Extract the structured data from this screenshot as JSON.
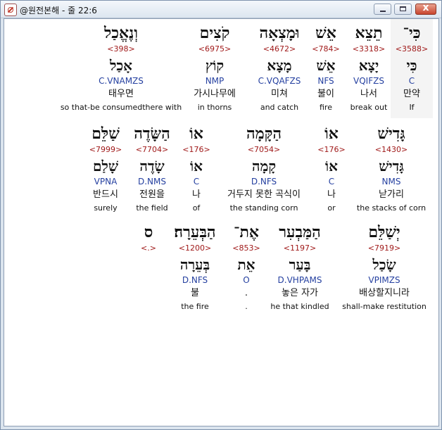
{
  "window": {
    "title": "@원전본해 - 줄 22:6",
    "minimize_label": "",
    "maximize_label": "",
    "close_label": "x"
  },
  "verse": {
    "words": [
      {
        "hebrew": "כִּי־",
        "strong": "<3588>",
        "lexeme": "כִּי",
        "morph": "C",
        "korean": "만약",
        "english": "If"
      },
      {
        "hebrew": "תֵצֵא",
        "strong": "<3318>",
        "lexeme": "יָצָא",
        "morph": "VQIFZS",
        "korean": "나서",
        "english": "break out"
      },
      {
        "hebrew": "אֵשׁ",
        "strong": "<784>",
        "lexeme": "אֵשׁ",
        "morph": "NFS",
        "korean": "불이",
        "english": "fire"
      },
      {
        "hebrew": "וּמָצְאָה",
        "strong": "<4672>",
        "lexeme": "מָצָא",
        "morph": "C.VQAFZS",
        "korean": "미쳐",
        "english": "and catch"
      },
      {
        "hebrew": "קֹצִים",
        "strong": "<6975>",
        "lexeme": "קוֹץ",
        "morph": "NMP",
        "korean": "가시나무에",
        "english": "in thorns"
      },
      {
        "hebrew": "וְנֶאֱכַל",
        "strong": "<398>",
        "lexeme": "אָכַל",
        "morph": "C.VNAMZS",
        "korean": "태우면",
        "english": "so that-be consumedthere with"
      },
      {
        "hebrew": "גָּדִישׁ",
        "strong": "<1430>",
        "lexeme": "גָּדִישׁ",
        "morph": "NMS",
        "korean": "낟가리",
        "english": "the stacks of corn"
      },
      {
        "hebrew": "אוֹ",
        "strong": "<176>",
        "lexeme": "אוֹ",
        "morph": "C",
        "korean": "나",
        "english": "or"
      },
      {
        "hebrew": "הַקָּמָה",
        "strong": "<7054>",
        "lexeme": "קָמָה",
        "morph": "D.NFS",
        "korean": "거두지 못한 곡식이",
        "english": "the standing corn"
      },
      {
        "hebrew": "אוֹ",
        "strong": "<176>",
        "lexeme": "אוֹ",
        "morph": "C",
        "korean": "나",
        "english": "of"
      },
      {
        "hebrew": "הַשָּׂדֶה",
        "strong": "<7704>",
        "lexeme": "שָׂדֶה",
        "morph": "D.NMS",
        "korean": "전원을",
        "english": "the field"
      },
      {
        "hebrew": "שַׁלֵּם",
        "strong": "<7999>",
        "lexeme": "שָׁלַם",
        "morph": "VPNA",
        "korean": "반드시",
        "english": "surely"
      },
      {
        "hebrew": "יְשַׁלֵּם",
        "strong": "<7919>",
        "lexeme": "שָׂכַל",
        "morph": "VPIMZS",
        "korean": "배상할지니라",
        "english": "shall-make restitution"
      },
      {
        "hebrew": "הַמַּבְעִר",
        "strong": "<1197>",
        "lexeme": "בָּעַר",
        "morph": "D.VHPAMS",
        "korean": "놓은 자가",
        "english": "he that kindled"
      },
      {
        "hebrew": "אֶת־",
        "strong": "<853>",
        "lexeme": "אֵת",
        "morph": "O",
        "korean": ".",
        "english": "."
      },
      {
        "hebrew": "הַבְּעֵרָה׃",
        "strong": "<1200>",
        "lexeme": "בְּעֵרָה",
        "morph": "D.NFS",
        "korean": "불",
        "english": "the fire"
      },
      {
        "hebrew": "ס",
        "strong": "<.>",
        "lexeme": "",
        "morph": "",
        "korean": "",
        "english": ""
      }
    ]
  }
}
